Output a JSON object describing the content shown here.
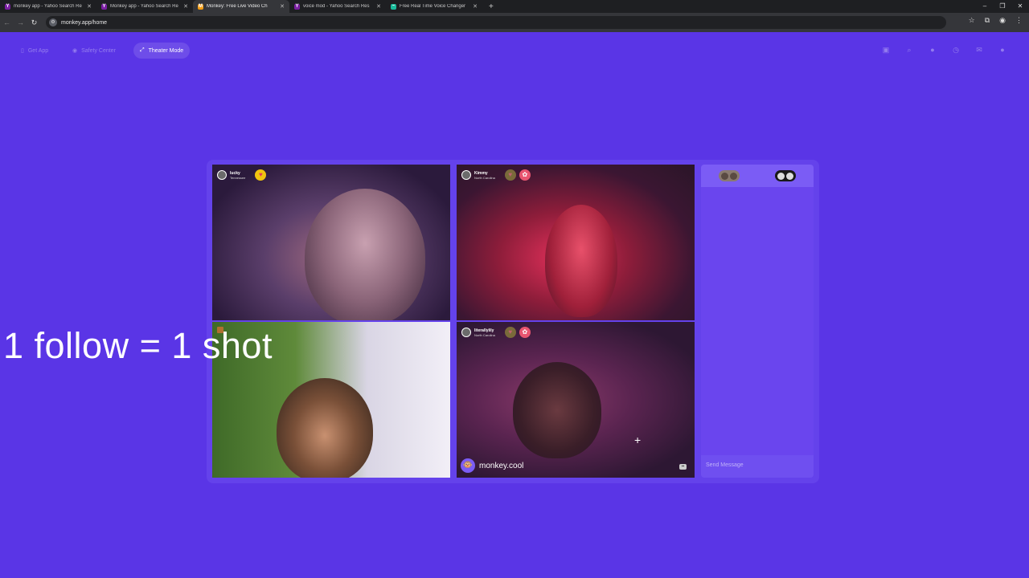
{
  "browser": {
    "tabs": [
      {
        "title": "monkey app - Yahoo Search Re",
        "favicon": "Y",
        "color": "#7b1fa2",
        "active": false
      },
      {
        "title": "Monkey app - Yahoo Search Re",
        "favicon": "Y",
        "color": "#7b1fa2",
        "active": false
      },
      {
        "title": "Monkey: Free Live Video Ch",
        "favicon": "M",
        "color": "#f39c12",
        "active": true
      },
      {
        "title": "voice mod - Yahoo Search Res",
        "favicon": "Y",
        "color": "#7b1fa2",
        "active": false
      },
      {
        "title": "Free Real Time Voice Changer",
        "favicon": "~",
        "color": "#1abc9c",
        "active": false
      }
    ],
    "url": "monkey.app/home"
  },
  "header": {
    "get_app": "Get App",
    "safety_center": "Safety Center",
    "theater_mode": "Theater Mode"
  },
  "overlay_text": "1 follow = 1 shot",
  "tiles": [
    {
      "name": "lucky",
      "location": "Tennessee"
    },
    {
      "name": "Kimmy",
      "location": "North Carolina"
    },
    {
      "name": "",
      "location": ""
    },
    {
      "name": "literallylily",
      "location": "North Carolina"
    }
  ],
  "watermark": "monkey.cool",
  "chat": {
    "placeholder": "Send Message"
  },
  "colors": {
    "background": "#5a35e6",
    "accent": "#7b5cf5"
  }
}
